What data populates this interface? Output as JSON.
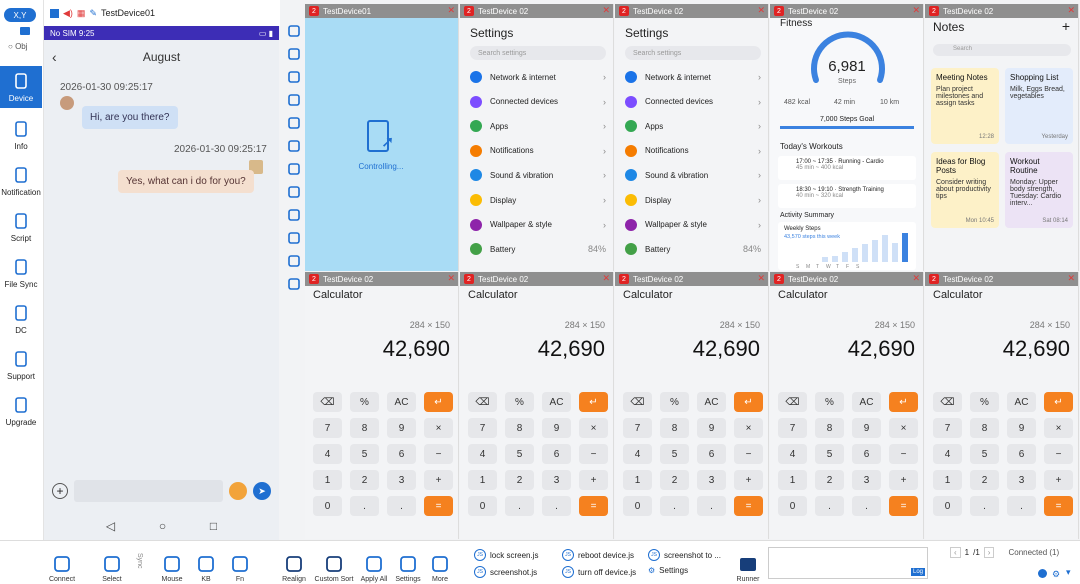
{
  "sidebar": {
    "xy_label": "X,Y",
    "obj_label": "Obj",
    "items": [
      {
        "label": "Device",
        "icon": "phone-icon"
      },
      {
        "label": "Info",
        "icon": "info-doc-icon"
      },
      {
        "label": "Notification",
        "icon": "chat-icon"
      },
      {
        "label": "Script",
        "icon": "script-icon"
      },
      {
        "label": "File Sync",
        "icon": "file-sync-icon"
      },
      {
        "label": "DC",
        "icon": "dc-icon"
      },
      {
        "label": "Support",
        "icon": "headset-icon"
      },
      {
        "label": "Upgrade",
        "icon": "upgrade-icon"
      }
    ]
  },
  "phone_window": {
    "device_name": "TestDevice01",
    "status_left": "No SIM 9:25",
    "chat_title": "August",
    "messages": [
      {
        "timestamp": "2026-01-30 09:25:17",
        "text": "Hi, are you there?",
        "side": "left"
      },
      {
        "timestamp": "2026-01-30 09:25:17",
        "text": "Yes, what can i do for you?",
        "side": "right"
      }
    ]
  },
  "tiles": {
    "first": {
      "name": "TestDevice01",
      "badge": "2",
      "status": "Controlling..."
    },
    "device_name": "TestDevice 02",
    "badge": "2",
    "settings": {
      "title": "Settings",
      "search_placeholder": "Search settings",
      "items": [
        {
          "label": "Network & internet",
          "color": "#1a73e8"
        },
        {
          "label": "Connected devices",
          "color": "#7c4dff"
        },
        {
          "label": "Apps",
          "color": "#34a853"
        },
        {
          "label": "Notifications",
          "color": "#f57c00"
        },
        {
          "label": "Sound & vibration",
          "color": "#1e88e5"
        },
        {
          "label": "Display",
          "color": "#fbbc04"
        },
        {
          "label": "Wallpaper & style",
          "color": "#8e24aa"
        },
        {
          "label": "Battery",
          "color": "#43a047",
          "value": "84%"
        }
      ]
    },
    "fitness": {
      "title": "Fitness",
      "steps_value": "6,981",
      "steps_label": "Steps",
      "steps_progress": 0.9973,
      "stats": [
        "482 kcal",
        "42 min",
        "10 km"
      ],
      "goal": "7,000 Steps Goal",
      "workouts_title": "Today's Workouts",
      "workouts": [
        {
          "line1": "17:00 ~ 17:35 · Running - Cardio",
          "line2": "45 min ~ 400 kcal"
        },
        {
          "line1": "18:30 ~ 19:10 · Strength Training",
          "line2": "40 min ~ 320 kcal"
        }
      ],
      "summary_title": "Activity Summary",
      "weekly_label": "Weekly Steps",
      "weekly_value": "43,570 steps this week",
      "days": [
        "S",
        "M",
        "T",
        "W",
        "T",
        "F",
        "S"
      ],
      "week_bars": [
        0.15,
        0.2,
        0.3,
        0.45,
        0.55,
        0.7,
        0.85,
        0.6,
        0.9
      ]
    },
    "notes": {
      "title": "Notes",
      "search_placeholder": "Search",
      "cards": [
        {
          "title": "Meeting Notes",
          "body": "Plan project milestones and assign tasks",
          "time": "12:28",
          "color": "#fdf1c8"
        },
        {
          "title": "Shopping List",
          "body": "Milk, Eggs Bread, vegetables",
          "time": "Yesterday",
          "color": "#e3ecfb"
        },
        {
          "title": "Ideas for Blog Posts",
          "body": "Consider writing about productivity tips",
          "time": "Mon 10:45",
          "color": "#fdf1c8"
        },
        {
          "title": "Workout Routine",
          "body": "Monday: Upper body strength, Tuesday: Cardio interv...",
          "time": "Sat 08:14",
          "color": "#ece3f5"
        }
      ]
    },
    "calculator": {
      "title": "Calculator",
      "expression": "284 × 150",
      "result": "42,690",
      "keys": [
        "⌫",
        "%",
        "AC",
        "↵",
        "7",
        "8",
        "9",
        "×",
        "4",
        "5",
        "6",
        "−",
        "1",
        "2",
        "3",
        "+",
        "0",
        ".",
        ".",
        "="
      ]
    }
  },
  "toolbar": {
    "buttons": [
      "Connect",
      "Select",
      "Mouse",
      "KB",
      "Fn",
      "Realign",
      "Custom Sort",
      "Apply All",
      "Settings",
      "More"
    ],
    "sync_label": "Sync",
    "scripts": [
      "lock screen.js",
      "reboot device.js",
      "screenshot to ...",
      "screenshot.js",
      "turn off device.js"
    ],
    "settings_label": "Settings",
    "runner_label": "Runner",
    "log_label": "Log",
    "page_current": "1",
    "page_total": "/1",
    "connected": "Connected (1)"
  }
}
